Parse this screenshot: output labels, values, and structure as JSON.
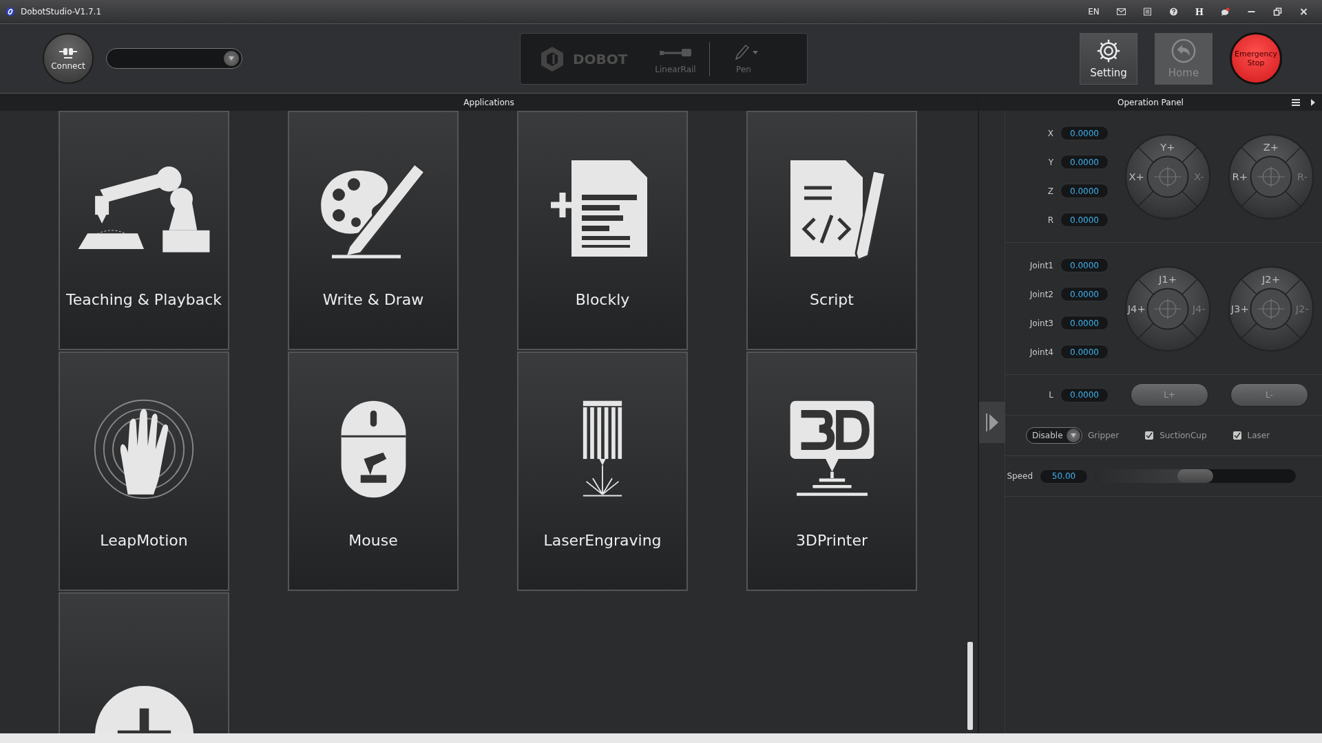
{
  "window": {
    "title": "DobotStudio-V1.7.1"
  },
  "title_bar": {
    "language": "EN",
    "h_label": "H"
  },
  "toolbar": {
    "connect": "Connect",
    "brand": "DOBOT",
    "devices": [
      {
        "label": "LinearRail",
        "kind": "rail"
      },
      {
        "label": "Pen",
        "kind": "pen"
      }
    ],
    "buttons": [
      {
        "label": "Setting",
        "kind": "setting",
        "disabled": false
      },
      {
        "label": "Home",
        "kind": "home",
        "disabled": true
      }
    ],
    "emergency": "Emergency Stop"
  },
  "applications": {
    "title": "Applications",
    "tiles": [
      {
        "label": "Teaching & Playback",
        "kind": "teaching"
      },
      {
        "label": "Write & Draw",
        "kind": "draw"
      },
      {
        "label": "Blockly",
        "kind": "blockly"
      },
      {
        "label": "Script",
        "kind": "script"
      },
      {
        "label": "LeapMotion",
        "kind": "leap"
      },
      {
        "label": "Mouse",
        "kind": "mouse"
      },
      {
        "label": "LaserEngraving",
        "kind": "laser"
      },
      {
        "label": "3DPrinter",
        "kind": "printer"
      },
      {
        "kind": "add"
      }
    ]
  },
  "operation_panel": {
    "title": "Operation Panel",
    "cartesian": [
      {
        "label": "X",
        "value": "0.0000"
      },
      {
        "label": "Y",
        "value": "0.0000"
      },
      {
        "label": "Z",
        "value": "0.0000"
      },
      {
        "label": "R",
        "value": "0.0000"
      }
    ],
    "cartesian_dials": [
      {
        "top": "Y+",
        "left": "X+",
        "right": "X-"
      },
      {
        "top": "Z+",
        "left": "R+",
        "right": "R-"
      }
    ],
    "joints": [
      {
        "label": "Joint1",
        "value": "0.0000"
      },
      {
        "label": "Joint2",
        "value": "0.0000"
      },
      {
        "label": "Joint3",
        "value": "0.0000"
      },
      {
        "label": "Joint4",
        "value": "0.0000"
      }
    ],
    "joint_dials": [
      {
        "top": "J1+",
        "left": "J4+",
        "right": "J4-"
      },
      {
        "top": "J2+",
        "left": "J3+",
        "right": "J2-"
      }
    ],
    "rail": {
      "label": "L",
      "value": "0.0000",
      "buttons": [
        "L+",
        "L-"
      ]
    },
    "end_effector": {
      "mode": "Disable",
      "gripper": "Gripper",
      "options": [
        {
          "label": "SuctionCup",
          "checked": true
        },
        {
          "label": "Laser",
          "checked": true
        }
      ]
    },
    "speed": {
      "label": "Speed",
      "value": "50.00",
      "level": 0.5
    }
  }
}
